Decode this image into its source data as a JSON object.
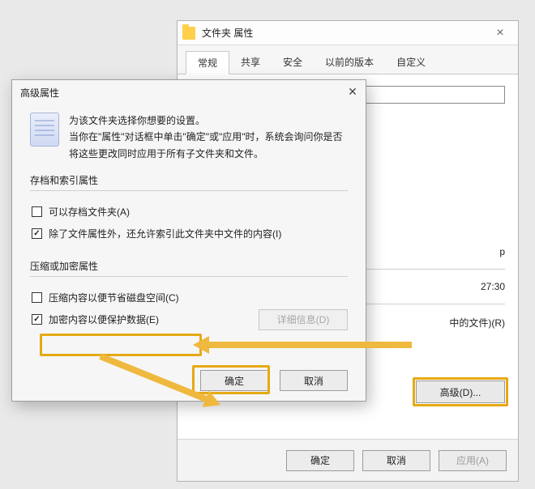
{
  "props": {
    "title": "文件夹 属性",
    "tabs": [
      "常规",
      "共享",
      "安全",
      "以前的版本",
      "自定义"
    ],
    "active_tab": 0,
    "name_value": "",
    "type_suffix": "p",
    "time_value": "27:30",
    "attr_line": "中的文件)(R)",
    "advanced_btn": "高级(D)...",
    "ok": "确定",
    "cancel": "取消",
    "apply": "应用(A)"
  },
  "adv": {
    "title": "高级属性",
    "intro1": "为该文件夹选择你想要的设置。",
    "intro2": "当你在\"属性\"对话框中单击\"确定\"或\"应用\"时，系统会询问你是否将这些更改同时应用于所有子文件夹和文件。",
    "group1_title": "存档和索引属性",
    "opt_archive": {
      "label": "可以存档文件夹(A)",
      "checked": false
    },
    "opt_index": {
      "label": "除了文件属性外，还允许索引此文件夹中文件的内容(I)",
      "checked": true
    },
    "group2_title": "压缩或加密属性",
    "opt_compress": {
      "label": "压缩内容以便节省磁盘空间(C)",
      "checked": false
    },
    "opt_encrypt": {
      "label": "加密内容以便保护数据(E)",
      "checked": true
    },
    "details_btn": "详细信息(D)",
    "ok": "确定",
    "cancel": "取消"
  }
}
